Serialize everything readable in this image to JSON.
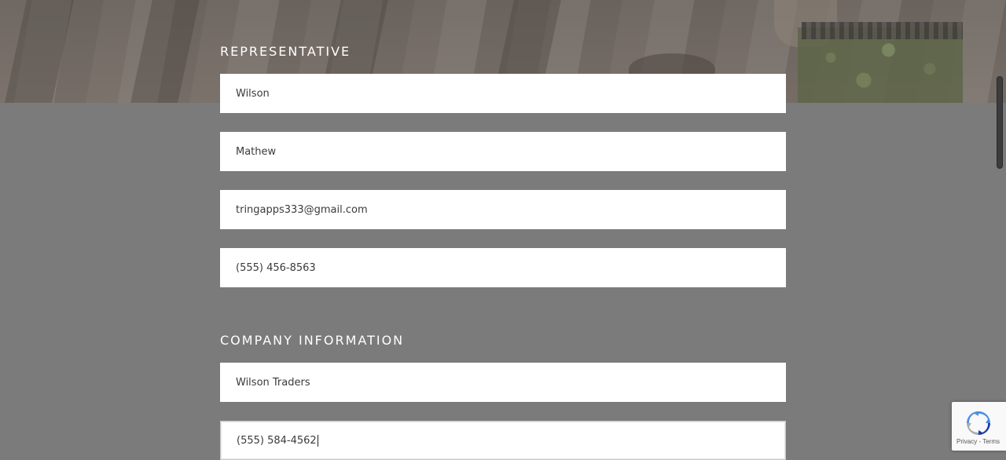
{
  "representative": {
    "heading": "REPRESENTATIVE",
    "last_name": "Wilson",
    "first_name": "Mathew",
    "email": "tringapps333@gmail.com",
    "phone": "(555) 456-8563"
  },
  "company": {
    "heading": "COMPANY INFORMATION",
    "name": "Wilson Traders",
    "phone": "(555) 584-4562"
  },
  "recaptcha": {
    "privacy": "Privacy",
    "separator": " - ",
    "terms": "Terms",
    "icon": "recaptcha-logo-icon"
  },
  "colors": {
    "overlay": "#7b7b7b",
    "field_bg": "#ffffff",
    "heading_text": "#ffffff"
  }
}
